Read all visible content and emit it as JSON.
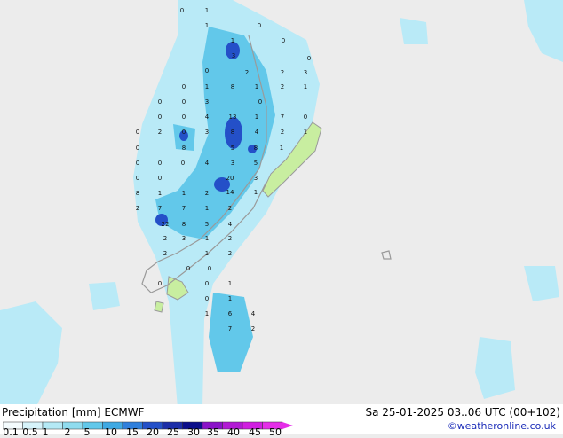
{
  "header": {
    "title": "Precipitation [mm] ECMWF",
    "valid_time": "Sa 25-01-2025 03..06 UTC (00+102)",
    "credit": "©weatheronline.co.uk"
  },
  "legend": {
    "labels": [
      "0.1",
      "0.5",
      "1",
      "2",
      "5",
      "10",
      "15",
      "20",
      "25",
      "30",
      "35",
      "40",
      "45",
      "50"
    ],
    "colors": [
      "#f4fbfd",
      "#d6f3fa",
      "#b4e9f5",
      "#8fdcef",
      "#62c8ea",
      "#3fa9e3",
      "#2f7fdc",
      "#2450c8",
      "#1c2ea8",
      "#0b0e8a",
      "#8a12c8",
      "#b21ad4",
      "#d01ee0",
      "#e52ee8"
    ]
  },
  "map": {
    "background": "#ececec",
    "land_color": "#c8eea0",
    "precip_light": "#b9eaf7",
    "precip_medium": "#62c8ea",
    "precip_heavy": "#2450c8",
    "values": [
      "1",
      "1",
      "3",
      "0",
      "0",
      "0",
      "1",
      "2",
      "0",
      "0",
      "0",
      "2",
      "3",
      "8",
      "0",
      "1",
      "1",
      "2",
      "1",
      "3",
      "0",
      "0",
      "0",
      "0",
      "3",
      "8",
      "13",
      "1",
      "7",
      "0",
      "0",
      "2",
      "4",
      "0",
      "8",
      "5",
      "8",
      "4",
      "2",
      "1",
      "0",
      "0",
      "0",
      "4",
      "3",
      "5",
      "1",
      "0",
      "0",
      "0",
      "20",
      "14",
      "3",
      "1",
      "8",
      "1",
      "1",
      "2",
      "2",
      "7",
      "7",
      "1",
      "2",
      "22",
      "8",
      "5",
      "4",
      "3",
      "2",
      "1",
      "2",
      "2",
      "1",
      "2",
      "0",
      "0",
      "1",
      "6",
      "1",
      "7",
      "4",
      "2",
      "0",
      "1",
      "0",
      "0"
    ]
  }
}
